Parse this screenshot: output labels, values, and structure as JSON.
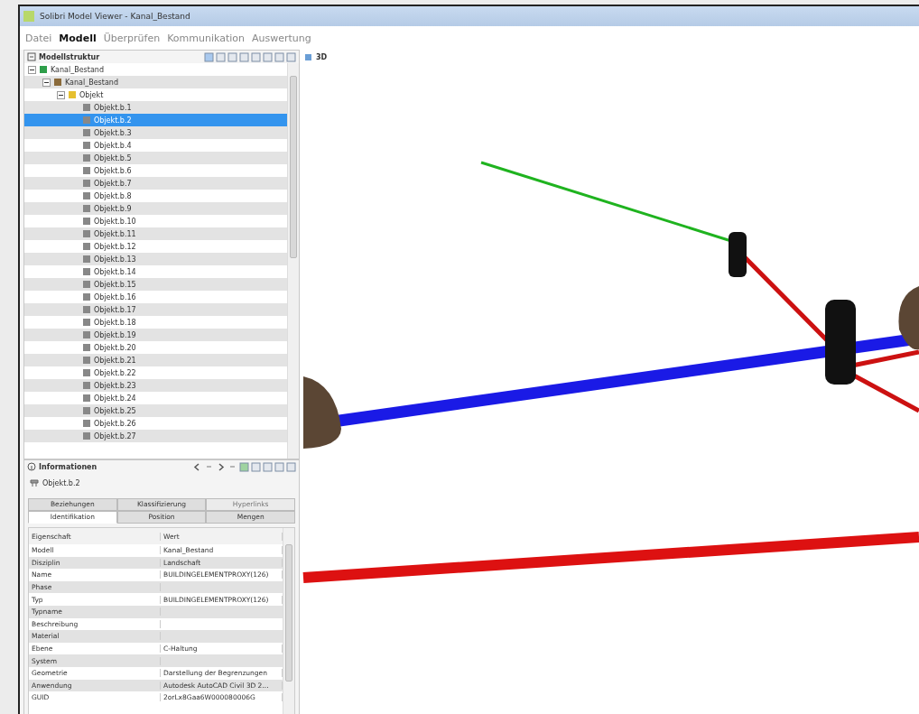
{
  "window": {
    "title": "Solibri Model Viewer - Kanal_Bestand"
  },
  "menu": [
    {
      "label": "Datei",
      "selected": false
    },
    {
      "label": "Modell",
      "selected": true
    },
    {
      "label": "Überprüfen",
      "selected": false
    },
    {
      "label": "Kommunikation",
      "selected": false
    },
    {
      "label": "Auswertung",
      "selected": false
    }
  ],
  "model_tree": {
    "title": "Modellstruktur",
    "items": [
      {
        "label": "Kanal_Bestand",
        "kind": "model",
        "selected": false,
        "expanded": true,
        "children": [
          {
            "label": "Kanal_Bestand",
            "kind": "building",
            "selected": false,
            "expanded": true,
            "children": [
              {
                "label": "Objekt",
                "kind": "folder",
                "selected": false,
                "expanded": true,
                "children": [
                  {
                    "label": "Objekt.b.1",
                    "kind": "object",
                    "selected": false
                  },
                  {
                    "label": "Objekt.b.2",
                    "kind": "object",
                    "selected": true
                  },
                  {
                    "label": "Objekt.b.3",
                    "kind": "object",
                    "selected": false
                  },
                  {
                    "label": "Objekt.b.4",
                    "kind": "object",
                    "selected": false
                  },
                  {
                    "label": "Objekt.b.5",
                    "kind": "object",
                    "selected": false
                  },
                  {
                    "label": "Objekt.b.6",
                    "kind": "object",
                    "selected": false
                  },
                  {
                    "label": "Objekt.b.7",
                    "kind": "object",
                    "selected": false
                  },
                  {
                    "label": "Objekt.b.8",
                    "kind": "object",
                    "selected": false
                  },
                  {
                    "label": "Objekt.b.9",
                    "kind": "object",
                    "selected": false
                  },
                  {
                    "label": "Objekt.b.10",
                    "kind": "object",
                    "selected": false
                  },
                  {
                    "label": "Objekt.b.11",
                    "kind": "object",
                    "selected": false
                  },
                  {
                    "label": "Objekt.b.12",
                    "kind": "object",
                    "selected": false
                  },
                  {
                    "label": "Objekt.b.13",
                    "kind": "object",
                    "selected": false
                  },
                  {
                    "label": "Objekt.b.14",
                    "kind": "object",
                    "selected": false
                  },
                  {
                    "label": "Objekt.b.15",
                    "kind": "object",
                    "selected": false
                  },
                  {
                    "label": "Objekt.b.16",
                    "kind": "object",
                    "selected": false
                  },
                  {
                    "label": "Objekt.b.17",
                    "kind": "object",
                    "selected": false
                  },
                  {
                    "label": "Objekt.b.18",
                    "kind": "object",
                    "selected": false
                  },
                  {
                    "label": "Objekt.b.19",
                    "kind": "object",
                    "selected": false
                  },
                  {
                    "label": "Objekt.b.20",
                    "kind": "object",
                    "selected": false
                  },
                  {
                    "label": "Objekt.b.21",
                    "kind": "object",
                    "selected": false
                  },
                  {
                    "label": "Objekt.b.22",
                    "kind": "object",
                    "selected": false
                  },
                  {
                    "label": "Objekt.b.23",
                    "kind": "object",
                    "selected": false
                  },
                  {
                    "label": "Objekt.b.24",
                    "kind": "object",
                    "selected": false
                  },
                  {
                    "label": "Objekt.b.25",
                    "kind": "object",
                    "selected": false
                  },
                  {
                    "label": "Objekt.b.26",
                    "kind": "object",
                    "selected": false
                  },
                  {
                    "label": "Objekt.b.27",
                    "kind": "object",
                    "selected": false
                  }
                ]
              }
            ]
          }
        ]
      }
    ]
  },
  "info": {
    "title": "Informationen",
    "object": "Objekt.b.2",
    "tab_rows": [
      [
        {
          "label": "Beziehungen",
          "selected": false,
          "disabled": false
        },
        {
          "label": "Klassifizierung",
          "selected": false,
          "disabled": false
        },
        {
          "label": "Hyperlinks",
          "selected": false,
          "disabled": true
        }
      ],
      [
        {
          "label": "Identifikation",
          "selected": true,
          "disabled": false
        },
        {
          "label": "Position",
          "selected": false,
          "disabled": false
        },
        {
          "label": "Mengen",
          "selected": false,
          "disabled": false
        }
      ]
    ],
    "columns": [
      "Eigenschaft",
      "Wert"
    ],
    "rows": [
      {
        "property": "Modell",
        "value": "Kanal_Bestand"
      },
      {
        "property": "Disziplin",
        "value": "Landschaft"
      },
      {
        "property": "Name",
        "value": "BUILDINGELEMENTPROXY(126)"
      },
      {
        "property": "Phase"
      },
      {
        "property": "Typ",
        "value": "BUILDINGELEMENTPROXY(126)"
      },
      {
        "property": "Typname"
      },
      {
        "property": "Beschreibung"
      },
      {
        "property": "Material"
      },
      {
        "property": "Ebene",
        "value": "C-Haltung"
      },
      {
        "property": "System"
      },
      {
        "property": "Geometrie",
        "value": "Darstellung der Begrenzungen"
      },
      {
        "property": "Anwendung",
        "value": "Autodesk AutoCAD Civil 3D 2..."
      },
      {
        "property": "GUID",
        "value": "2orLx8Gaa6W000080006G"
      }
    ]
  },
  "view": {
    "label": "3D"
  }
}
